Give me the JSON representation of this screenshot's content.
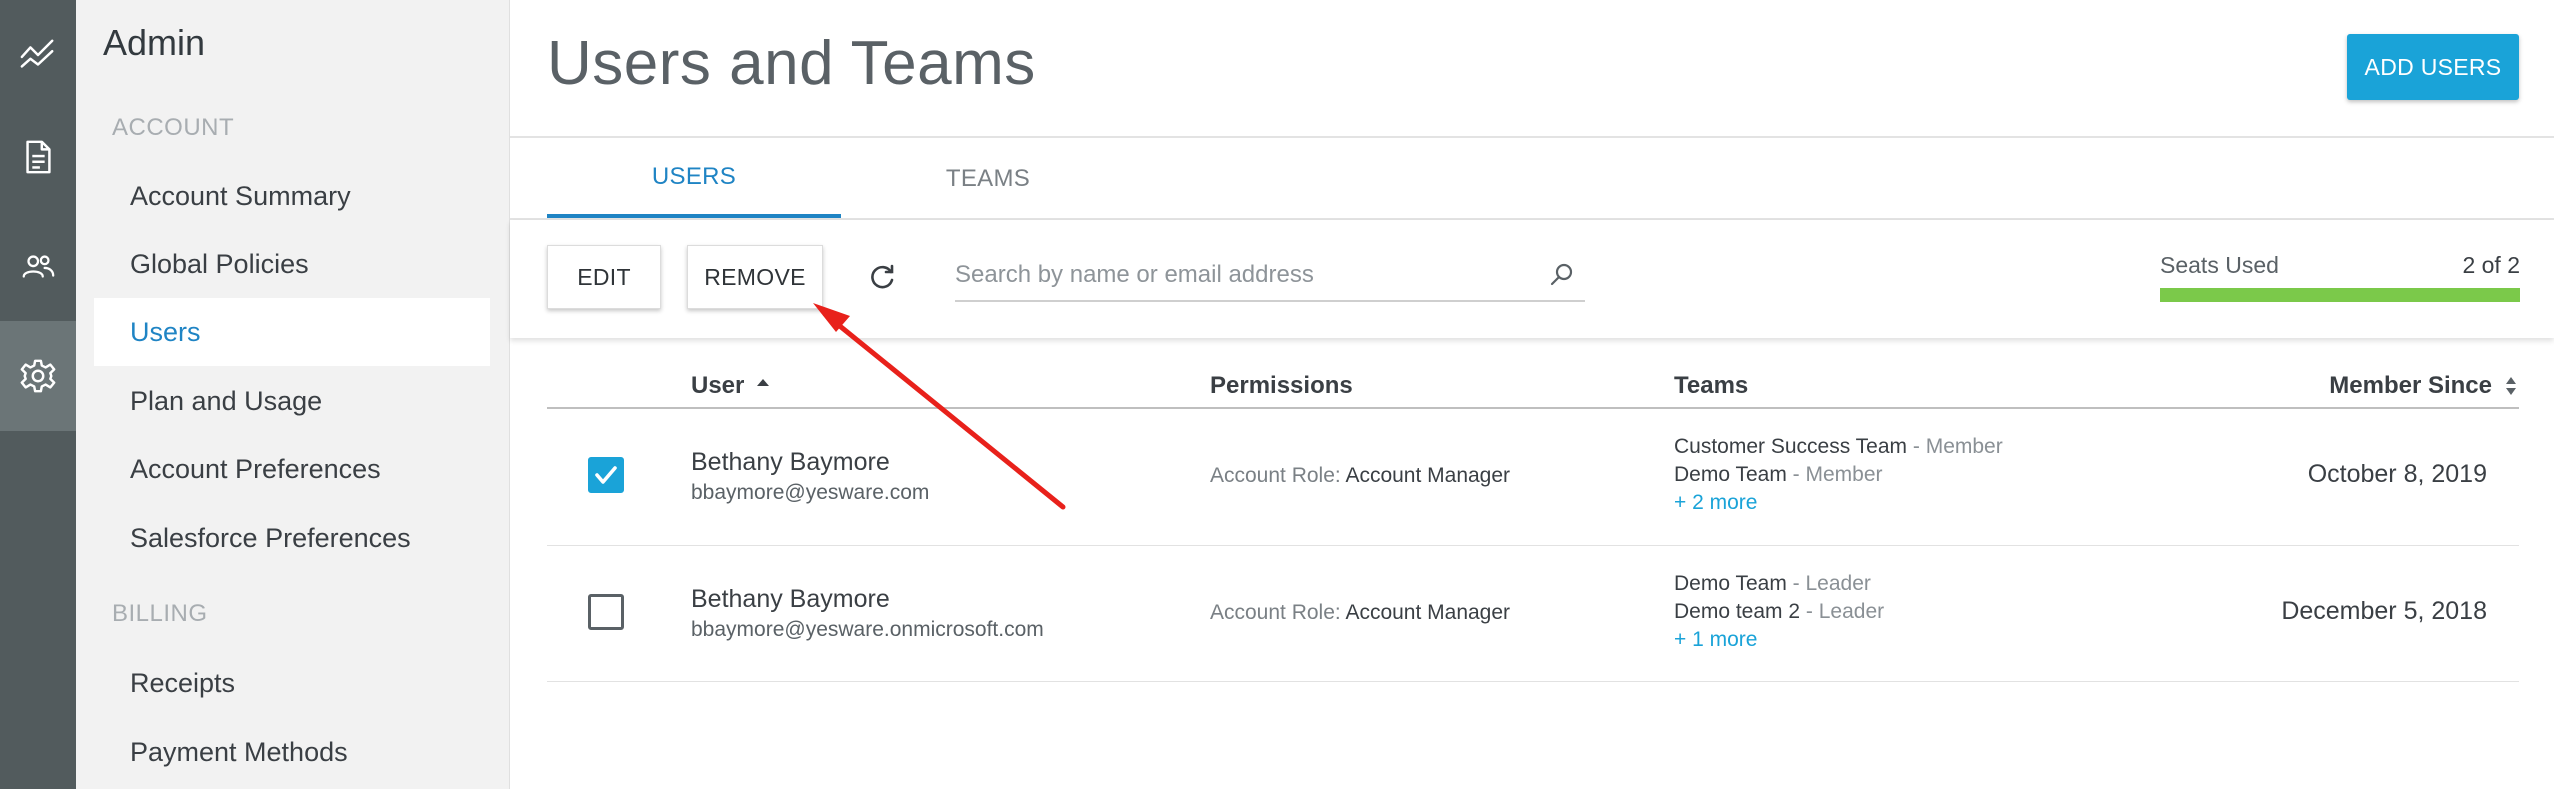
{
  "rail": {
    "items": [
      {
        "icon": "analytics-icon"
      },
      {
        "icon": "document-icon"
      },
      {
        "icon": "people-icon"
      },
      {
        "icon": "gear-icon"
      }
    ]
  },
  "sidebar": {
    "title": "Admin",
    "account_section": "ACCOUNT",
    "account_items": [
      {
        "label": "Account Summary"
      },
      {
        "label": "Global Policies"
      },
      {
        "label": "Users"
      },
      {
        "label": "Plan and Usage"
      },
      {
        "label": "Account Preferences"
      },
      {
        "label": "Salesforce Preferences"
      }
    ],
    "billing_section": "BILLING",
    "billing_items": [
      {
        "label": "Receipts"
      },
      {
        "label": "Payment Methods"
      }
    ]
  },
  "header": {
    "title": "Users and Teams",
    "add_users_label": "ADD USERS"
  },
  "tabs": [
    {
      "label": "USERS"
    },
    {
      "label": "TEAMS"
    }
  ],
  "toolbar": {
    "edit_label": "EDIT",
    "remove_label": "REMOVE",
    "search_placeholder": "Search by name or email address",
    "seats_label": "Seats Used",
    "seats_count": "2 of 2",
    "seats_used_fraction": 1.0
  },
  "table": {
    "columns": {
      "user": "User",
      "permissions": "Permissions",
      "teams": "Teams",
      "member_since": "Member Since"
    },
    "rows": [
      {
        "checked": true,
        "name": "Bethany Baymore",
        "email": "bbaymore@yesware.com",
        "role_key": "Account Role:",
        "role_value": "Account Manager",
        "teams": [
          {
            "name": "Customer Success Team",
            "role": "- Member"
          },
          {
            "name": "Demo Team",
            "role": "- Member"
          }
        ],
        "more": "+ 2 more",
        "since": "October 8, 2019"
      },
      {
        "checked": false,
        "name": "Bethany Baymore",
        "email": "bbaymore@yesware.onmicrosoft.com",
        "role_key": "Account Role:",
        "role_value": "Account Manager",
        "teams": [
          {
            "name": "Demo Team",
            "role": "- Leader"
          },
          {
            "name": "Demo team 2",
            "role": "- Leader"
          }
        ],
        "more": "+ 1 more",
        "since": "December 5, 2018"
      }
    ]
  },
  "colors": {
    "rail": "#525b5d",
    "accent": "#1aa3d8",
    "link": "#1f84c4",
    "seats_fill": "#7bc94a",
    "annotation_arrow": "#e8211b"
  }
}
